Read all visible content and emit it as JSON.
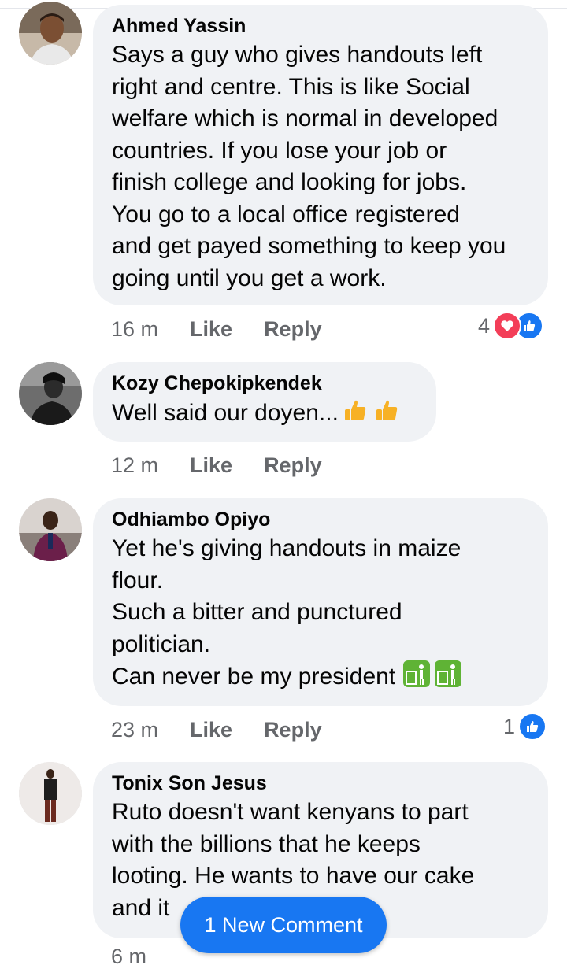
{
  "comments": [
    {
      "author": "Ahmed Yassin",
      "text": "Says a guy who gives handouts left\nright and centre. This is like Social\nwelfare which is normal in developed\ncountries. If you lose your job or\nfinish college and looking for jobs.\nYou go to a local office registered\nand get payed something to keep you\ngoing until you get a work.",
      "time": "16 m",
      "like_label": "Like",
      "reply_label": "Reply",
      "reaction_count": "4",
      "reactions": [
        "love-icon",
        "like-icon"
      ]
    },
    {
      "author": "Kozy Chepokipkendek",
      "text": "Well said our doyen...",
      "emojis": [
        "thumbs-up-icon",
        "thumbs-up-icon"
      ],
      "time": "12 m",
      "like_label": "Like",
      "reply_label": "Reply"
    },
    {
      "author": "Odhiambo Opiyo",
      "text": "Yet he's giving handouts in maize\nflour.\nSuch a bitter and punctured\npolitician.\nCan never be my president",
      "emojis": [
        "put-litter-in-bin-icon",
        "put-litter-in-bin-icon"
      ],
      "time": "23 m",
      "like_label": "Like",
      "reply_label": "Reply",
      "reaction_count": "1",
      "reactions": [
        "like-icon"
      ]
    },
    {
      "author": "Tonix Son Jesus",
      "text": "Ruto doesn't want kenyans to part\nwith the billions that he keeps\nlooting. He wants to have our cake\nand it",
      "time": "6 m"
    }
  ],
  "new_comment_label": "1 New Comment",
  "colors": {
    "bubble": "#f0f2f5",
    "meta_text": "#65676b",
    "accent": "#1877f2",
    "love": "#f33e58",
    "thumb": "#f7b125",
    "bin": "#5fb335"
  }
}
